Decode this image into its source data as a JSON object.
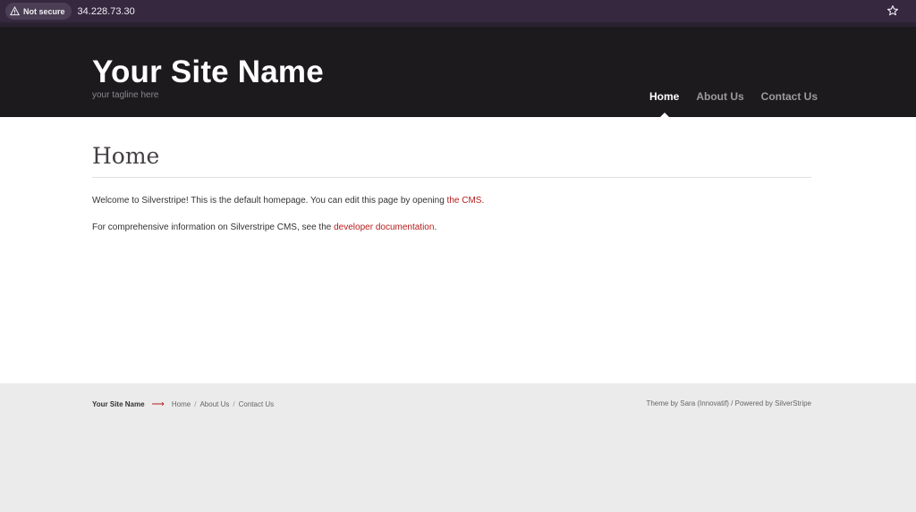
{
  "browser": {
    "security_label": "Not secure",
    "url": "34.228.73.30"
  },
  "header": {
    "site_name": "Your Site Name",
    "tagline": "your tagline here",
    "nav": [
      {
        "label": "Home",
        "active": true
      },
      {
        "label": "About Us",
        "active": false
      },
      {
        "label": "Contact Us",
        "active": false
      }
    ]
  },
  "main": {
    "title": "Home",
    "p1_text": "Welcome to Silverstripe! This is the default homepage. You can edit this page by opening ",
    "p1_link": "the CMS",
    "p1_end": ".",
    "p2_text": "For comprehensive information on Silverstripe CMS, see the ",
    "p2_link": "developer documentation",
    "p2_end": "."
  },
  "footer": {
    "site_name": "Your Site Name",
    "arrow": "⟶",
    "links": [
      "Home",
      "About Us",
      "Contact Us"
    ],
    "separator": "/",
    "credit": "Theme by Sara (Innovatif) / Powered by SilverStripe"
  },
  "colors": {
    "browser_bar": "#35283f",
    "header_bg": "#1c1a1d",
    "accent_link": "#b51b1b",
    "footer_bg": "#ebebeb"
  }
}
